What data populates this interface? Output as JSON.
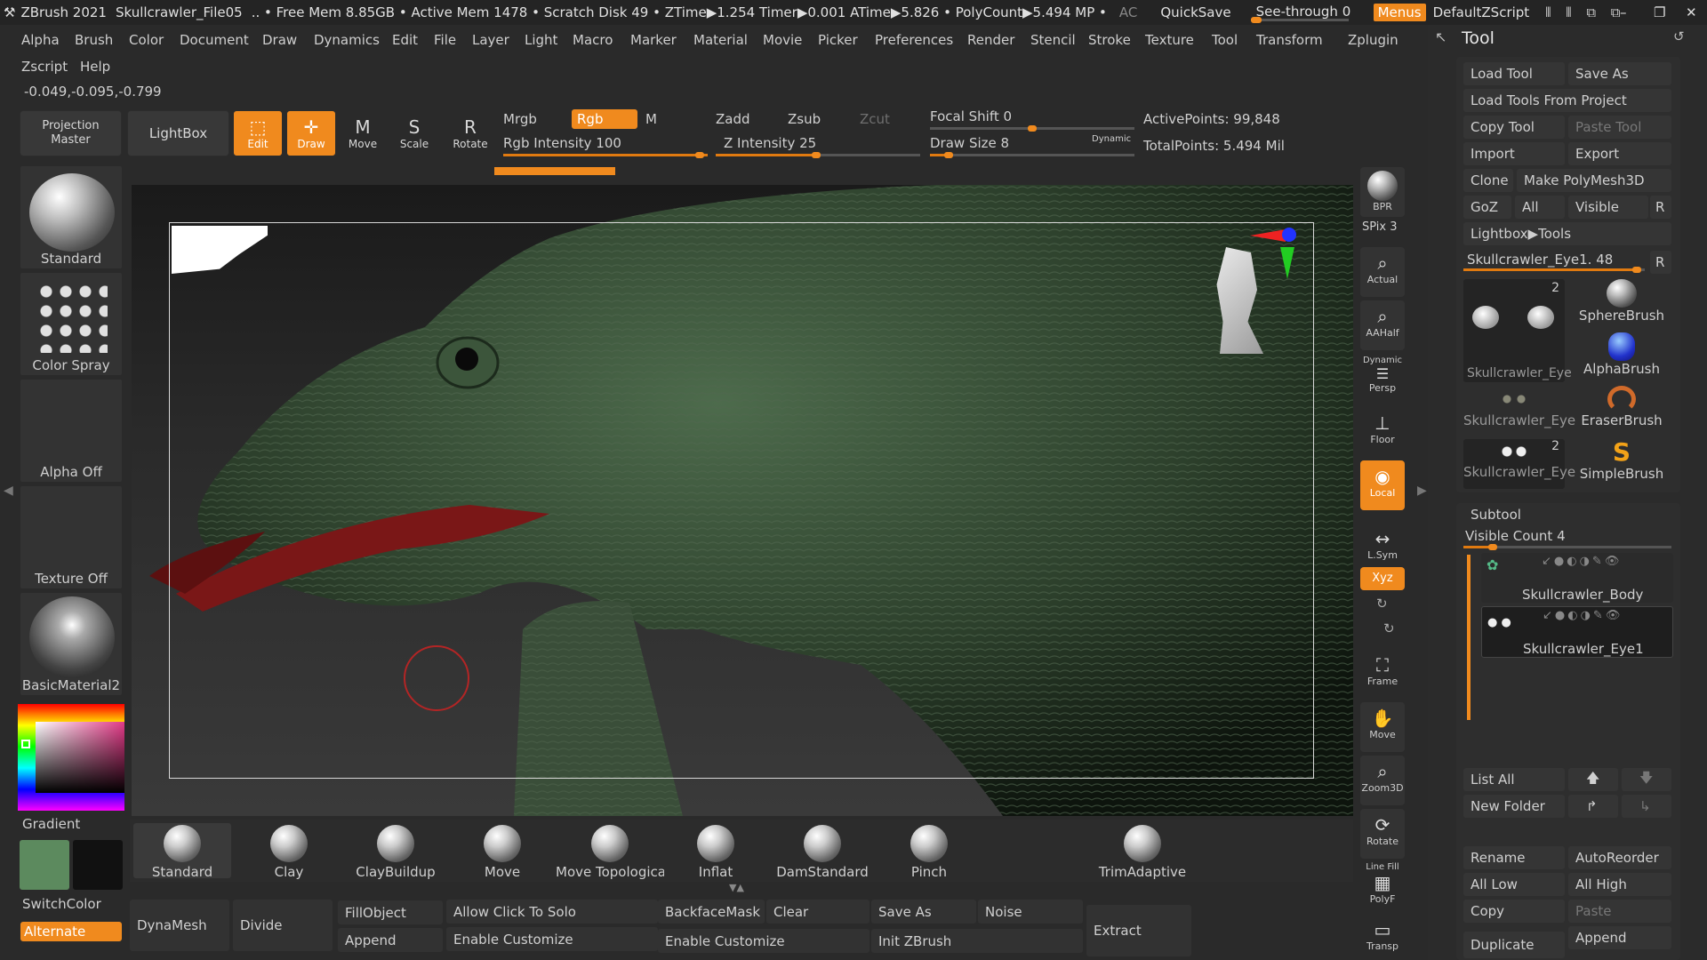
{
  "titlebar": {
    "app": "ZBrush 2021",
    "file": "Skullcrawler_File05",
    "stats": ".. • Free Mem 8.85GB • Active Mem 1478 • Scratch Disk 49 • ZTime▶1.254 Timer▶0.001 ATime▶5.826 • PolyCount▶5.494 MP •",
    "ac": "AC",
    "quicksave": "QuickSave",
    "see_through": "See-through  0",
    "menus": "Menus",
    "script": "DefaultZScript"
  },
  "menus": [
    "Alpha",
    "Brush",
    "Color",
    "Document",
    "Draw",
    "Dynamics",
    "Edit",
    "File",
    "Layer",
    "Light",
    "Macro",
    "Marker",
    "Material",
    "Movie",
    "Picker",
    "Preferences",
    "Render",
    "Stencil",
    "Stroke",
    "Texture",
    "Tool",
    "Transform",
    "Zplugin"
  ],
  "menus2": [
    "Zscript",
    "Help"
  ],
  "coords": "-0.049,-0.095,-0.799",
  "toolbar": {
    "projection_master": "Projection Master",
    "lightbox": "LightBox",
    "edit": "Edit",
    "draw": "Draw",
    "move": "Move",
    "scale": "Scale",
    "rotate": "Rotate",
    "mrgb": "Mrgb",
    "rgb": "Rgb",
    "m": "M",
    "rgb_intensity": "Rgb Intensity 100",
    "zadd": "Zadd",
    "zsub": "Zsub",
    "zcut": "Zcut",
    "z_intensity": "Z Intensity 25",
    "focal_shift": "Focal Shift 0",
    "draw_size": "Draw Size 8",
    "dynamic": "Dynamic",
    "active_points": "ActivePoints: 99,848",
    "total_points": "TotalPoints: 5.494 Mil"
  },
  "left": {
    "brush": "Standard",
    "stroke": "Color Spray",
    "alpha": "Alpha Off",
    "texture": "Texture Off",
    "material": "BasicMaterial2",
    "gradient": "Gradient",
    "switchcolor": "SwitchColor",
    "alternate": "Alternate"
  },
  "shelf": [
    "BPR",
    "SPix 3",
    "Actual",
    "AAHalf",
    "Persp",
    "Floor",
    "Local",
    "L.Sym",
    "Xyz",
    "Frame",
    "Move",
    "Zoom3D",
    "Rotate",
    "PolyF",
    "Transp"
  ],
  "shelf_extra": {
    "dynamic": "Dynamic",
    "linefill": "Line Fill"
  },
  "brushes": [
    "Standard",
    "Clay",
    "ClayBuildup",
    "Move",
    "Move Topologica",
    "Inflat",
    "DamStandard",
    "Pinch",
    "TrimAdaptive"
  ],
  "bottom": {
    "dynamesh": "DynaMesh",
    "divide": "Divide",
    "fillobject": "FillObject",
    "append": "Append",
    "allow_solo": "Allow Click To Solo",
    "enable_customize1": "Enable Customize",
    "backfacemask": "BackfaceMask",
    "clear": "Clear",
    "enable_customize2": "Enable Customize",
    "save_as": "Save As",
    "init_zbrush": "Init ZBrush",
    "noise": "Noise",
    "extract": "Extract"
  },
  "tool": {
    "title": "Tool",
    "load_tool": "Load Tool",
    "save_as": "Save As",
    "load_from_project": "Load Tools From Project",
    "copy_tool": "Copy Tool",
    "paste_tool": "Paste Tool",
    "import": "Import",
    "export": "Export",
    "clone": "Clone",
    "make_polymesh": "Make PolyMesh3D",
    "goz": "GoZ",
    "all": "All",
    "visible": "Visible",
    "r": "R",
    "lightbox_tools": "Lightbox▶Tools",
    "current_tool": "Skullcrawler_Eye1. 48",
    "thumbs": [
      {
        "label": "Skullcrawler_Eye",
        "count": "2"
      },
      {
        "label": "SphereBrush",
        "count": ""
      },
      {
        "label": "AlphaBrush",
        "count": ""
      },
      {
        "label": "Skullcrawler_Eye",
        "count": ""
      },
      {
        "label": "EraserBrush",
        "count": ""
      },
      {
        "label": "Skullcrawler_Eye",
        "count": "2"
      },
      {
        "label": "SimpleBrush",
        "count": ""
      }
    ],
    "subtool": "Subtool",
    "visible_count": "Visible Count 4",
    "subtools": [
      "Skullcrawler_Body",
      "Skullcrawler_Eye1"
    ],
    "list_all": "List All",
    "new_folder": "New Folder",
    "rename": "Rename",
    "autoreorder": "AutoReorder",
    "all_low": "All Low",
    "all_high": "All High",
    "copy": "Copy",
    "paste": "Paste",
    "duplicate": "Duplicate",
    "append": "Append"
  }
}
